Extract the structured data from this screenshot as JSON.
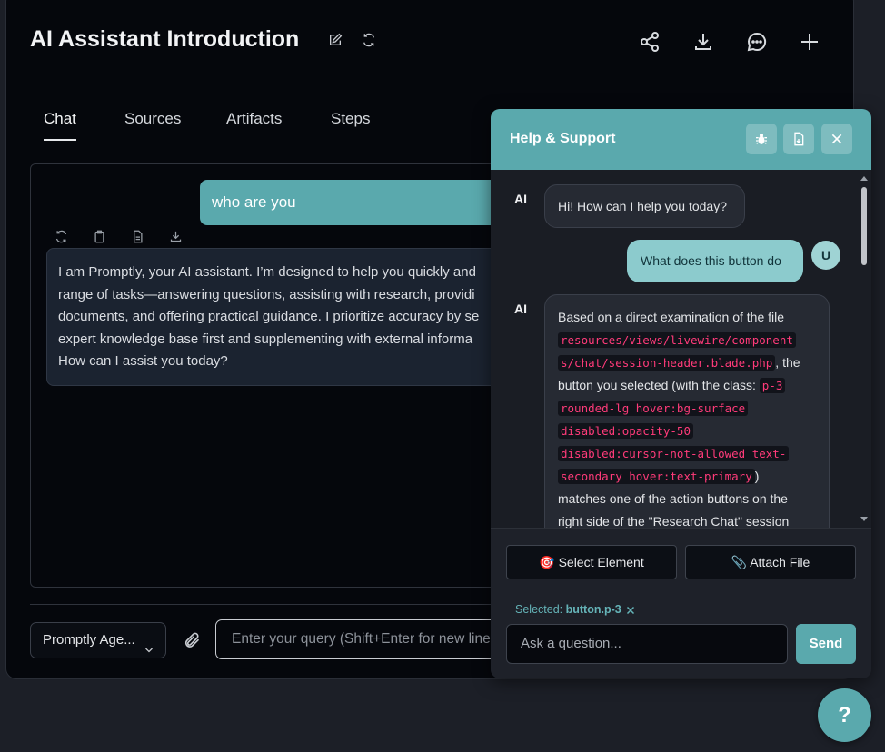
{
  "header": {
    "title": "AI Assistant Introduction"
  },
  "tabs": [
    {
      "label": "Chat",
      "active": true
    },
    {
      "label": "Sources"
    },
    {
      "label": "Artifacts"
    },
    {
      "label": "Steps"
    }
  ],
  "chat": {
    "user_message": "who are you",
    "ai_lines": [
      "I am Promptly, your AI assistant. I’m designed to help you quickly and",
      "range of tasks—answering questions, assisting with research, providi",
      "documents, and offering practical guidance. I prioritize accuracy by se",
      "expert knowledge base first and supplementing with external informa",
      "How can I assist you today?"
    ]
  },
  "composer": {
    "agent_label": "Promptly Age...",
    "query_placeholder": "Enter your query (Shift+Enter for new line"
  },
  "help_panel": {
    "title": "Help & Support",
    "messages": {
      "ai_label": "AI",
      "greeting": "Hi! How can I help you today?",
      "user_question": "What does this button do",
      "user_avatar": "U",
      "answer": {
        "t1": "Based on a direct examination of the file",
        "path1": " resources/views/livewire/component",
        "path2": "s/chat/session-header.blade.php",
        "t2": ", the",
        "t3": "button you selected (with the class: ",
        "c1": "p-3",
        "c2": "rounded-lg hover:bg-surface",
        "c3": "disabled:opacity-50",
        "c4": "disabled:cursor-not-allowed text-",
        "c5": "secondary hover:text-primary",
        "t4": ")",
        "t5": "matches one of the action buttons on the",
        "t6": "right side of the \"Research Chat\" session"
      }
    },
    "select_element_label": "🎯 Select Element",
    "attach_file_label": "📎 Attach File",
    "selected_prefix": "Selected:",
    "selected_value": "button.p-3",
    "ask_placeholder": "Ask a question...",
    "send_label": "Send"
  },
  "help_fab_label": "?",
  "colors": {
    "accent": "#5aa9ad",
    "background": "#05070c",
    "code": "#ff3b7a"
  }
}
